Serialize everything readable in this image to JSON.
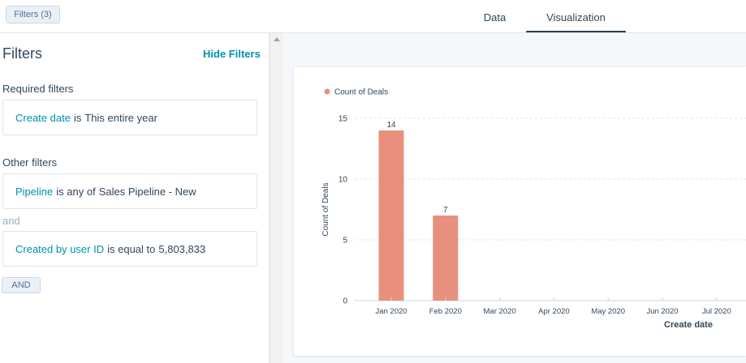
{
  "topbar": {
    "filters_chip": "Filters (3)",
    "tabs": [
      {
        "label": "Data",
        "active": false
      },
      {
        "label": "Visualization",
        "active": true
      }
    ]
  },
  "filters_panel": {
    "title": "Filters",
    "hide_label": "Hide Filters",
    "required_heading": "Required filters",
    "required": [
      {
        "property": "Create date",
        "operator": "is",
        "value": "This entire year"
      }
    ],
    "other_heading": "Other filters",
    "other": [
      {
        "property": "Pipeline",
        "operator": "is any of",
        "value": "Sales Pipeline - New"
      },
      {
        "property": "Created by user ID",
        "operator": "is equal to",
        "value": "5,803,833"
      }
    ],
    "joiner": "and",
    "and_button": "AND"
  },
  "colors": {
    "bar": "#e8907d",
    "link": "#0091ae",
    "text": "#33475b"
  },
  "chart_data": {
    "type": "bar",
    "legend": [
      "Count of Deals"
    ],
    "categories": [
      "Jan 2020",
      "Feb 2020",
      "Mar 2020",
      "Apr 2020",
      "May 2020",
      "Jun 2020",
      "Jul 2020"
    ],
    "values": [
      14,
      7,
      0,
      0,
      0,
      0,
      0
    ],
    "data_labels": [
      "14",
      "7",
      "",
      "",
      "",
      "",
      ""
    ],
    "xlabel": "Create date",
    "ylabel": "Count of Deals",
    "ylim": [
      0,
      15
    ],
    "yticks": [
      0,
      5,
      10,
      15
    ],
    "grid": true,
    "legend_position": "top-left"
  }
}
